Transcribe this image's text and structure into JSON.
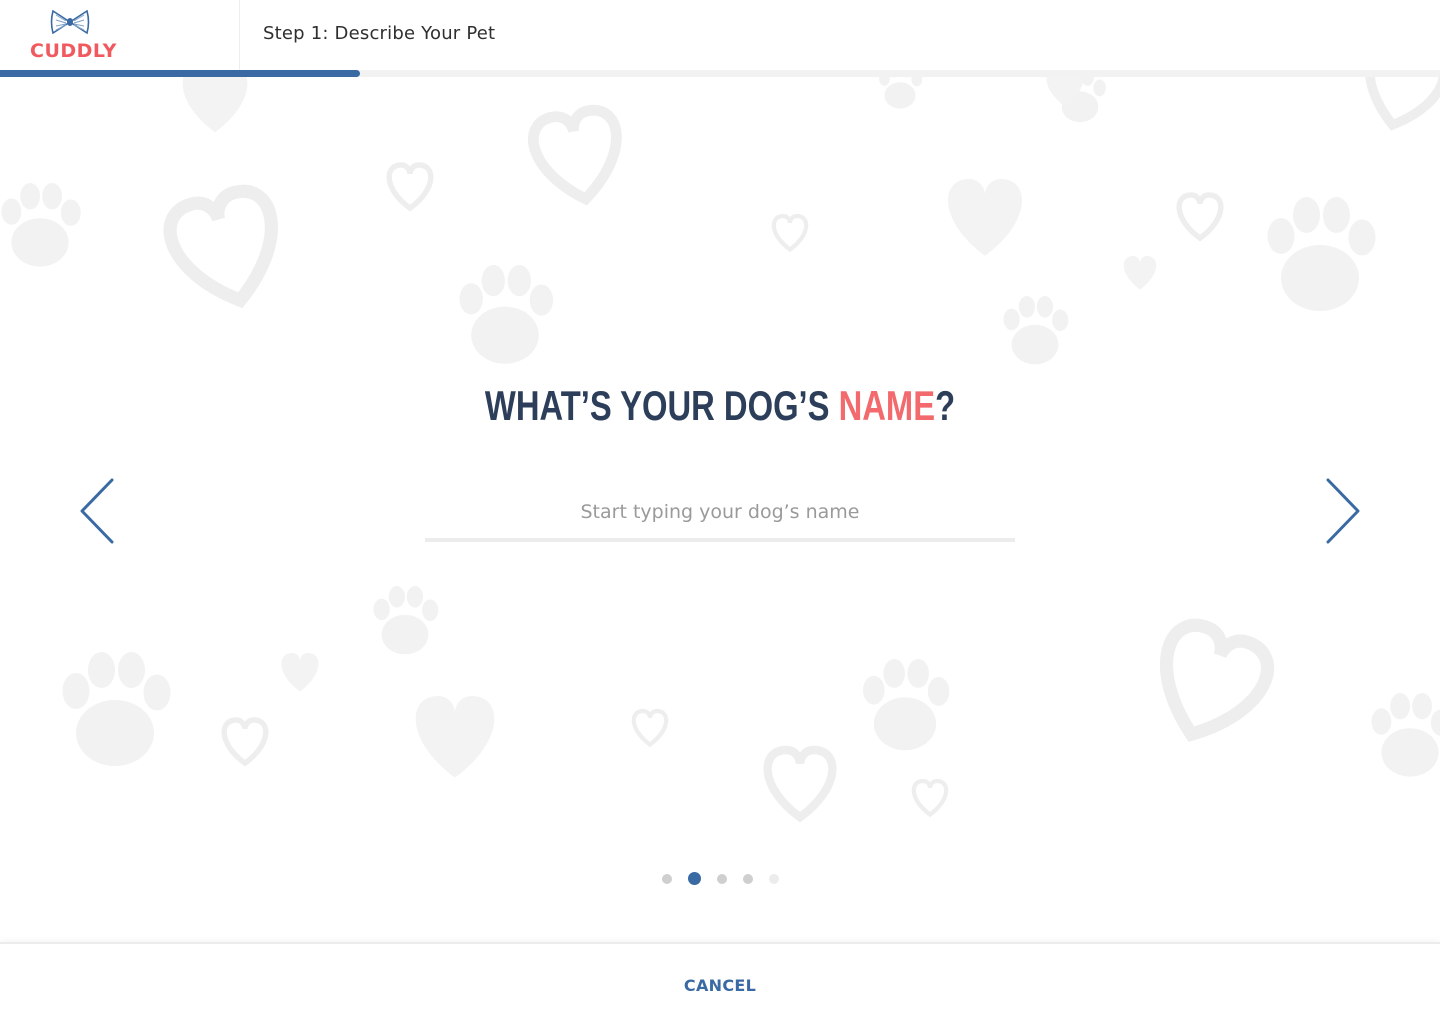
{
  "brand": {
    "name": "CUDDLY",
    "color": "#f05a5f",
    "icon": "bow-tie-icon"
  },
  "header": {
    "step_title": "Step 1: Describe Your Pet"
  },
  "progress": {
    "fraction": 0.25,
    "color": "#3a6aa3"
  },
  "main": {
    "question_prefix": "WHAT’S YOUR DOG’S ",
    "question_accent": "NAME",
    "question_suffix": "?",
    "input_placeholder": "Start typing your dog’s name",
    "input_value": "",
    "prev_icon": "chevron-left-icon",
    "next_icon": "chevron-right-icon"
  },
  "pagination": {
    "total": 5,
    "current": 2
  },
  "footer": {
    "cancel_label": "CANCEL"
  },
  "colors": {
    "accent": "#3a6aa3",
    "coral": "#f26a6e",
    "heading": "#2c3e5a"
  }
}
